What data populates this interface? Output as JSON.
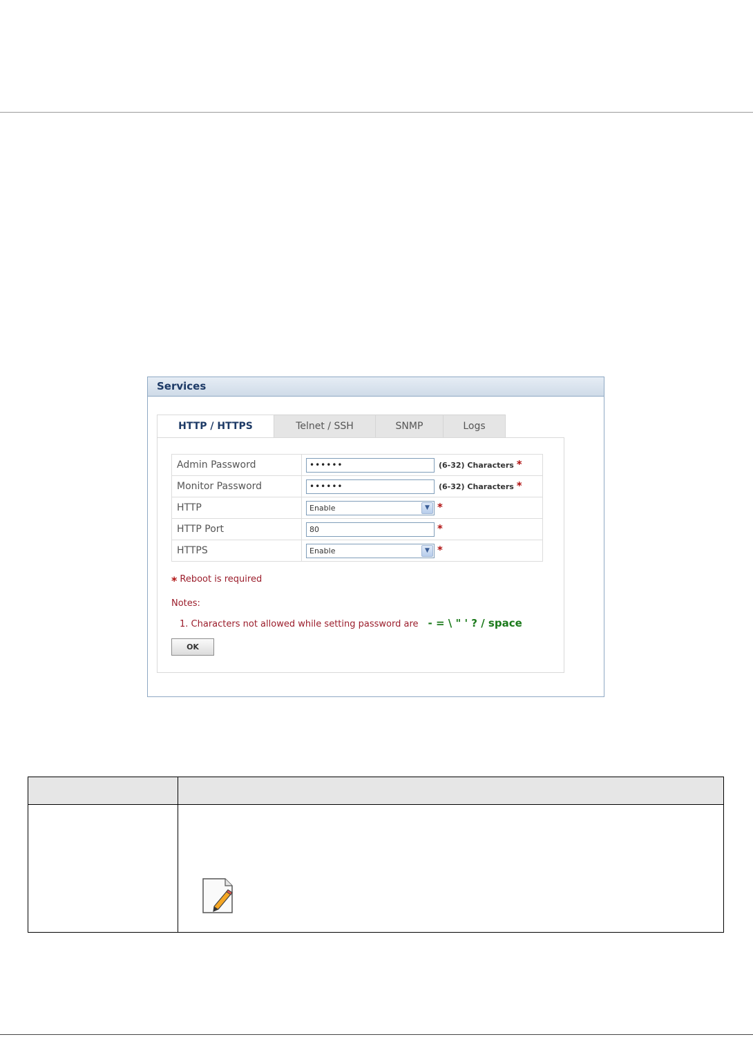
{
  "panel": {
    "title": "Services",
    "tabs": [
      {
        "label": "HTTP / HTTPS",
        "active": true
      },
      {
        "label": "Telnet / SSH",
        "active": false
      },
      {
        "label": "SNMP",
        "active": false
      },
      {
        "label": "Logs",
        "active": false
      }
    ],
    "form": {
      "rows": [
        {
          "label": "Admin Password",
          "value": "••••••",
          "hint": "(6-32) Characters",
          "required": "*"
        },
        {
          "label": "Monitor Password",
          "value": "••••••",
          "hint": "(6-32) Characters",
          "required": "*"
        },
        {
          "label": "HTTP",
          "value": "Enable",
          "required": "*"
        },
        {
          "label": "HTTP Port",
          "value": "80",
          "required": "*"
        },
        {
          "label": "HTTPS",
          "value": "Enable",
          "required": "*"
        }
      ]
    },
    "reboot_star": "*",
    "reboot_text": "Reboot is required",
    "notes_label": "Notes:",
    "note_1_text": "1. Characters not allowed while setting password are",
    "note_1_chars": "- = \\ \" ' ? / space",
    "ok_label": "OK"
  },
  "icons": {
    "dropdown": "chevron-down-icon",
    "note": "note-pencil-icon"
  },
  "colors": {
    "header_text": "#1d3a66",
    "required": "#b01010",
    "note_text": "#9b1d2b",
    "forbidden_chars": "#1b7a1b"
  }
}
